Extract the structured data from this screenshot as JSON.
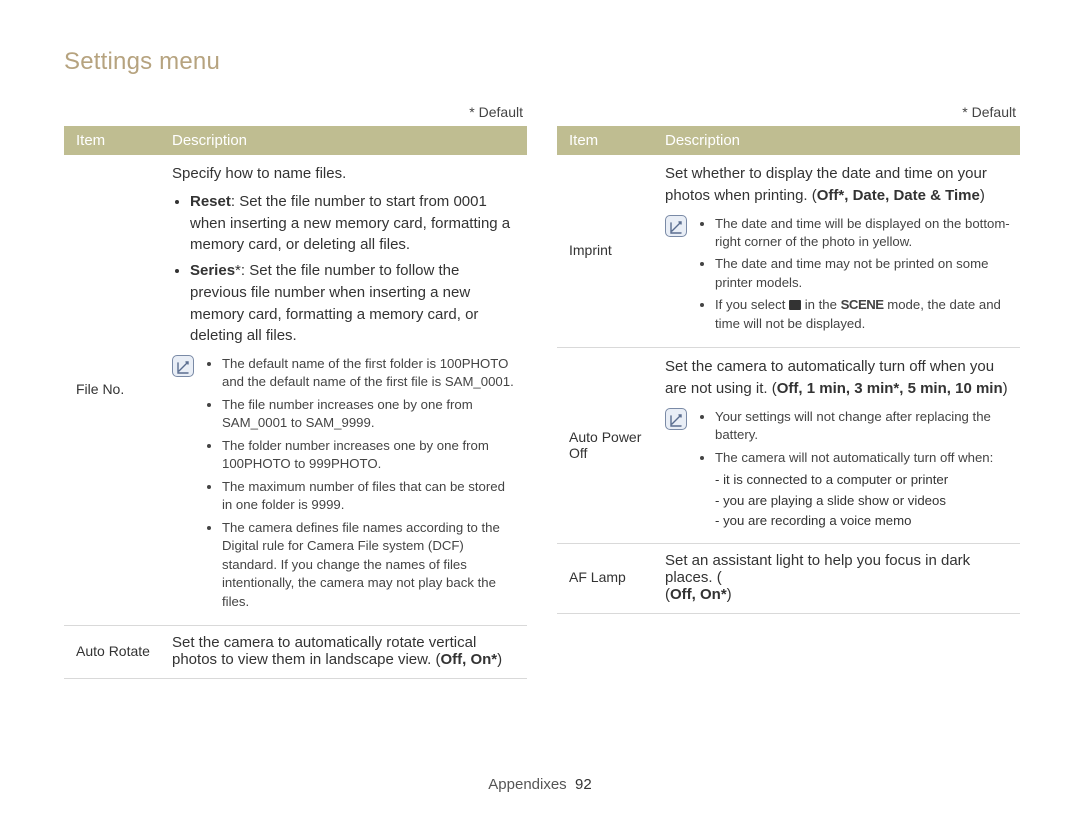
{
  "title": "Settings menu",
  "default_label": "* Default",
  "headers": {
    "item": "Item",
    "description": "Description"
  },
  "footer": {
    "section": "Appendixes",
    "page": "92"
  },
  "left": {
    "file_no": {
      "label": "File No.",
      "intro": "Specify how to name files.",
      "bullets": [
        {
          "name": "Reset",
          "text": ": Set the file number to start from 0001 when inserting a new memory card, formatting a memory card, or deleting all files."
        },
        {
          "name": "Series",
          "suffix": "*",
          "text": ": Set the file number to follow the previous file number when inserting a new memory card, formatting a memory card, or deleting all files."
        }
      ],
      "notes": [
        "The default name of the first folder is 100PHOTO and the default name of the first file is SAM_0001.",
        "The file number increases one by one from SAM_0001 to SAM_9999.",
        "The folder number increases one by one from 100PHOTO to 999PHOTO.",
        "The maximum number of files that can be stored in one folder is 9999.",
        "The camera defines file names according to the Digital rule for Camera File system (DCF) standard. If you change the names of files intentionally, the camera may not play back the files."
      ]
    },
    "auto_rotate": {
      "label": "Auto Rotate",
      "text": "Set the camera to automatically rotate vertical photos to view them in landscape view. (",
      "options": "Off, On*",
      "close": ")"
    }
  },
  "right": {
    "imprint": {
      "label": "Imprint",
      "intro": "Set whether to display the date and time on your photos when printing. (",
      "options": "Off*, Date, Date & Time",
      "close": ")",
      "notes": [
        "The date and time will be displayed on the bottom-right corner of the photo in yellow.",
        "The date and time may not be printed on some printer models."
      ],
      "note_scene_pre": "If you select ",
      "note_scene_mid": " in the ",
      "note_scene_word": "SCENE",
      "note_scene_post": " mode, the date and time will not be displayed."
    },
    "auto_power_off": {
      "label": "Auto Power Off",
      "intro": "Set the camera to automatically turn off when you are not using it. (",
      "options": "Off, 1 min, 3 min*, 5 min, 10 min",
      "close": ")",
      "notes_main": [
        "Your settings will not change after replacing the battery.",
        "The camera will not automatically turn off when:"
      ],
      "notes_sub": [
        "it is connected to a computer or printer",
        "you are playing a slide show or videos",
        "you are recording a voice memo"
      ]
    },
    "af_lamp": {
      "label": "AF Lamp",
      "text": "Set an assistant light to help you focus in dark places. (",
      "options": "Off, On*",
      "close": ")"
    }
  }
}
